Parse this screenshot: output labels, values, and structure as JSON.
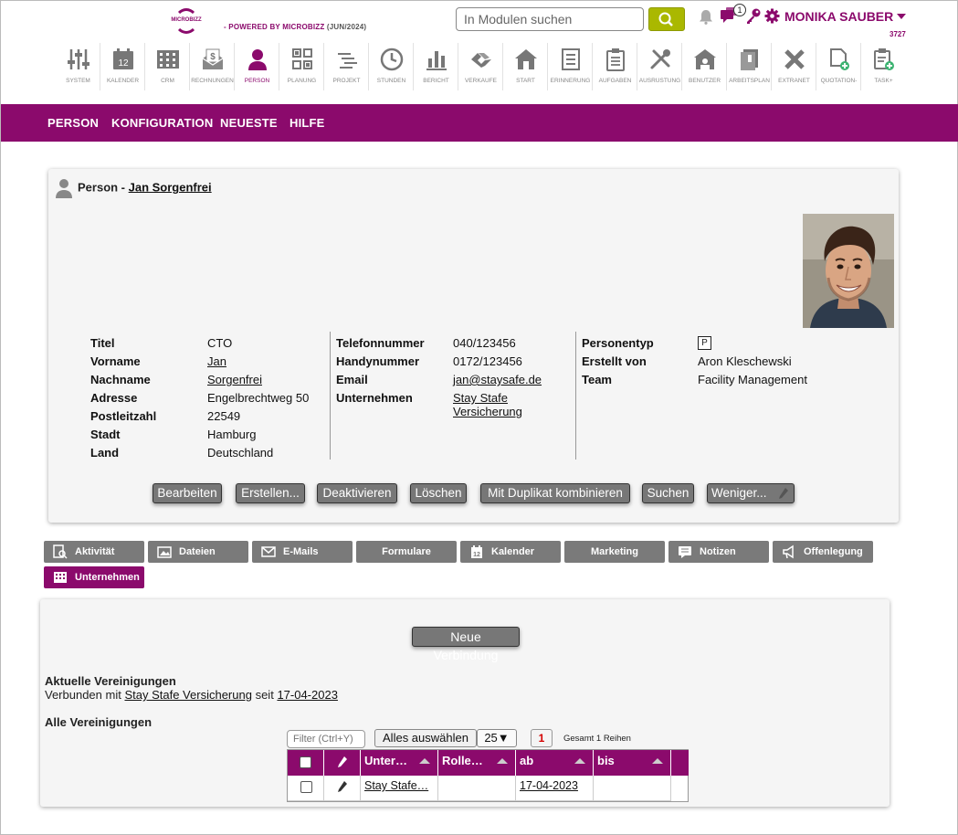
{
  "brand": {
    "logo_text": "MICROBIZZ",
    "powered": "- POWERED BY MICROBIZZ",
    "version": "(JUN/2024)"
  },
  "header": {
    "search_placeholder": "In Modulen suchen",
    "chat_count": "1",
    "user_name": "MONIKA SAUBER",
    "user_id": "3727"
  },
  "modules": [
    {
      "label": "SYSTEM",
      "icon": "sliders-icon"
    },
    {
      "label": "KALENDER",
      "icon": "calendar-icon"
    },
    {
      "label": "CRM",
      "icon": "building-icon"
    },
    {
      "label": "RECHNUNGEN",
      "icon": "invoice-icon"
    },
    {
      "label": "PERSON",
      "icon": "person-icon"
    },
    {
      "label": "PLANUNG",
      "icon": "planning-icon"
    },
    {
      "label": "PROJEKT",
      "icon": "project-icon"
    },
    {
      "label": "STUNDEN",
      "icon": "clock-icon"
    },
    {
      "label": "BERICHT",
      "icon": "bar-chart-icon"
    },
    {
      "label": "VERKÄUFE",
      "icon": "handshake-icon"
    },
    {
      "label": "START",
      "icon": "home-icon"
    },
    {
      "label": "ERINNERUNG",
      "icon": "reminder-icon"
    },
    {
      "label": "AUFGABEN",
      "icon": "clipboard-icon"
    },
    {
      "label": "AUSRÜSTUNG",
      "icon": "tools-icon"
    },
    {
      "label": "BENUTZER",
      "icon": "user-house-icon"
    },
    {
      "label": "ARBEITSPLAN",
      "icon": "workplan-icon"
    },
    {
      "label": "EXTRANET",
      "icon": "x-icon"
    },
    {
      "label": "QUOTATION-",
      "icon": "quotation-icon"
    },
    {
      "label": "TASK+",
      "icon": "task-plus-icon"
    }
  ],
  "nav": {
    "person": "PERSON",
    "config": "KONFIGURATION",
    "newest": "NEUESTE",
    "help": "HILFE"
  },
  "card": {
    "title_prefix": "Person - ",
    "person_name": "Jan Sorgenfrei",
    "col1": {
      "labels": [
        "Titel",
        "Vorname",
        "Nachname",
        "Adresse",
        "Postleitzahl",
        "Stadt",
        "Land"
      ],
      "values": [
        "CTO",
        "Jan",
        "Sorgenfrei",
        "Engelbrechtweg 50",
        "22549",
        "Hamburg",
        "Deutschland"
      ]
    },
    "col2": {
      "labels": [
        "Telefonnummer",
        "Handynummer",
        "Email",
        "Unternehmen"
      ],
      "values": [
        "040/123456",
        "0172/123456",
        "jan@staysafe.de",
        "Stay Stafe Versicherung"
      ]
    },
    "col3": {
      "labels": [
        "Personentyp",
        "Erstellt von",
        "Team"
      ],
      "values": [
        "P",
        "Aron Kleschewski",
        "Facility Management"
      ]
    },
    "buttons": {
      "edit": "Bearbeiten",
      "create": "Erstellen...",
      "deactivate": "Deaktivieren",
      "delete": "Löschen",
      "merge": "Mit Duplikat kombinieren",
      "search": "Suchen",
      "less": "Weniger..."
    }
  },
  "tabs": {
    "activity": "Aktivität",
    "files": "Dateien",
    "emails": "E-Mails",
    "forms": "Formulare",
    "calendar": "Kalender",
    "marketing": "Marketing",
    "notes": "Notizen",
    "disclosure": "Offenlegung",
    "company": "Unternehmen"
  },
  "assoc": {
    "new_link": "Neue Verbindung",
    "current_title": "Aktuelle Vereinigungen",
    "connected_prefix": "Verbunden mit",
    "connected_company": "Stay Stafe Versicherung",
    "since": "seit",
    "since_date": "17-04-2023",
    "all_title": "Alle Vereinigungen",
    "filter_placeholder": "Filter (Ctrl+Y)",
    "select_all": "Alles auswählen",
    "page_size": "25▼",
    "page": "1",
    "total": "Gesamt 1 Reihen",
    "columns": [
      "Unter…",
      "Rolle…",
      "ab",
      "bis"
    ],
    "rows": [
      {
        "company": "Stay Stafe…",
        "role": "",
        "from": "17-04-2023",
        "to": ""
      }
    ]
  },
  "colors": {
    "brand": "#8b0a6c",
    "search_button": "#aab800",
    "button_gray": "#777777"
  }
}
